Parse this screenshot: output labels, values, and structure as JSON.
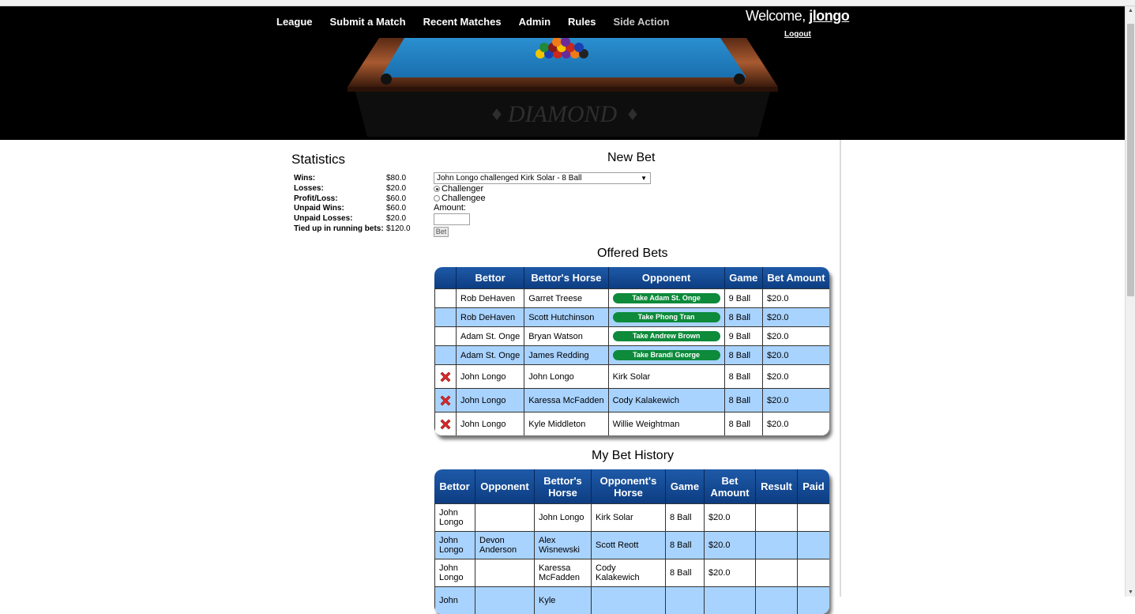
{
  "nav": {
    "items": [
      {
        "label": "League"
      },
      {
        "label": "Submit a Match"
      },
      {
        "label": "Recent Matches"
      },
      {
        "label": "Admin"
      },
      {
        "label": "Rules"
      },
      {
        "label": "Side Action"
      }
    ],
    "welcome_prefix": "Welcome,",
    "username": "jlongo",
    "logout": "Logout",
    "banner_text": "DIAMOND"
  },
  "statistics": {
    "title": "Statistics",
    "rows": [
      {
        "label": "Wins:",
        "value": "$80.0"
      },
      {
        "label": "Losses:",
        "value": "$20.0"
      },
      {
        "label": "Profit/Loss:",
        "value": "$60.0"
      },
      {
        "label": "Unpaid Wins:",
        "value": "$60.0"
      },
      {
        "label": "Unpaid Losses:",
        "value": "$20.0"
      },
      {
        "label": "Tied up in running bets:",
        "value": "$120.0"
      }
    ]
  },
  "new_bet": {
    "title": "New Bet",
    "selected_match": "John Longo challenged Kirk Solar - 8 Ball",
    "options": [
      {
        "label": "Challenger",
        "checked": true
      },
      {
        "label": "Challengee",
        "checked": false
      }
    ],
    "amount_label": "Amount:",
    "amount_value": "",
    "bet_button": "Bet"
  },
  "offered_bets": {
    "title": "Offered Bets",
    "headers": [
      "",
      "Bettor",
      "Bettor's Horse",
      "Opponent",
      "Game",
      "Bet Amount"
    ],
    "rows": [
      {
        "bettor": "Rob DeHaven",
        "horse": "Garret Treese",
        "opponent": "Take Adam St. Onge",
        "opponent_is_button": true,
        "game": "9 Ball",
        "amount": "$20.0",
        "deletable": false
      },
      {
        "bettor": "Rob DeHaven",
        "horse": "Scott Hutchinson",
        "opponent": "Take Phong Tran",
        "opponent_is_button": true,
        "game": "8 Ball",
        "amount": "$20.0",
        "deletable": false
      },
      {
        "bettor": "Adam St. Onge",
        "horse": "Bryan Watson",
        "opponent": "Take Andrew Brown",
        "opponent_is_button": true,
        "game": "9 Ball",
        "amount": "$20.0",
        "deletable": false
      },
      {
        "bettor": "Adam St. Onge",
        "horse": "James Redding",
        "opponent": "Take Brandi George",
        "opponent_is_button": true,
        "game": "8 Ball",
        "amount": "$20.0",
        "deletable": false
      },
      {
        "bettor": "John Longo",
        "horse": "John Longo",
        "opponent": "Kirk Solar",
        "opponent_is_button": false,
        "game": "8 Ball",
        "amount": "$20.0",
        "deletable": true
      },
      {
        "bettor": "John Longo",
        "horse": "Karessa McFadden",
        "opponent": "Cody Kalakewich",
        "opponent_is_button": false,
        "game": "8 Ball",
        "amount": "$20.0",
        "deletable": true
      },
      {
        "bettor": "John Longo",
        "horse": "Kyle Middleton",
        "opponent": "Willie Weightman",
        "opponent_is_button": false,
        "game": "8 Ball",
        "amount": "$20.0",
        "deletable": true
      }
    ]
  },
  "bet_history": {
    "title": "My Bet History",
    "headers": [
      "Bettor",
      "Opponent",
      "Bettor's Horse",
      "Opponent's Horse",
      "Game",
      "Bet Amount",
      "Result",
      "Paid"
    ],
    "rows": [
      {
        "bettor": "John Longo",
        "opponent": "",
        "horse": "John Longo",
        "opp_horse": "Kirk Solar",
        "game": "8 Ball",
        "amount": "$20.0",
        "result": "",
        "paid": ""
      },
      {
        "bettor": "John Longo",
        "opponent": "Devon Anderson",
        "horse": "Alex Wisnewski",
        "opp_horse": "Scott Reott",
        "game": "8 Ball",
        "amount": "$20.0",
        "result": "",
        "paid": ""
      },
      {
        "bettor": "John Longo",
        "opponent": "",
        "horse": "Karessa McFadden",
        "opp_horse": "Cody Kalakewich",
        "game": "8 Ball",
        "amount": "$20.0",
        "result": "",
        "paid": ""
      },
      {
        "bettor": "John",
        "opponent": "",
        "horse": "Kyle",
        "opp_horse": "",
        "game": "",
        "amount": "",
        "result": "",
        "paid": ""
      }
    ]
  },
  "colors": {
    "header_bg": "#000000",
    "table_header": "#0d3d82",
    "alt_row": "#a9d3ff",
    "take_button": "#0d8a3a",
    "delete_icon": "#d92b2b"
  }
}
